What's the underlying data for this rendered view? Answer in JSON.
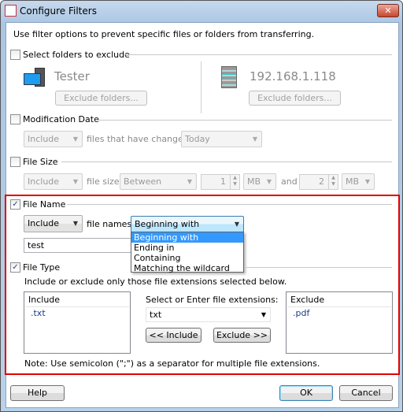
{
  "window": {
    "title": "Configure Filters",
    "close": "✕"
  },
  "intro": "Use filter options to prevent specific files or folders from transferring.",
  "folders": {
    "label": "Select folders to exclude",
    "checked": false,
    "local_name": "Tester",
    "remote_name": "192.168.1.118",
    "exclude_button": "Exclude folders..."
  },
  "mod_date": {
    "label": "Modification Date",
    "checked": false,
    "mode": "Include",
    "text": "files that have changed",
    "period": "Today"
  },
  "file_size": {
    "label": "File Size",
    "checked": false,
    "mode": "Include",
    "text": "file size",
    "comparison": "Between",
    "min": "1",
    "min_unit": "MB",
    "and": "and",
    "max": "2",
    "max_unit": "MB"
  },
  "file_name": {
    "label": "File Name",
    "checked": true,
    "mode": "Include",
    "text": "file names",
    "match": "Beginning with",
    "value": "test",
    "options": [
      "Beginning with",
      "Ending in",
      "Containing",
      "Matching the wildcard"
    ]
  },
  "file_type": {
    "label": "File Type",
    "checked": true,
    "description": "Include or exclude only those file extensions selected below.",
    "include_header": "Include",
    "include_items": [
      ".txt"
    ],
    "select_label": "Select or Enter file extensions:",
    "extension": "txt",
    "include_button": "<< Include",
    "exclude_button": "Exclude >>",
    "exclude_header": "Exclude",
    "exclude_items": [
      ".pdf"
    ],
    "note": "Note: Use semicolon (\";\") as a separator for multiple file extensions."
  },
  "footer": {
    "help": "Help",
    "ok": "OK",
    "cancel": "Cancel"
  },
  "colors": {
    "highlight": "#3399ff",
    "focus_box": "#e00000"
  }
}
